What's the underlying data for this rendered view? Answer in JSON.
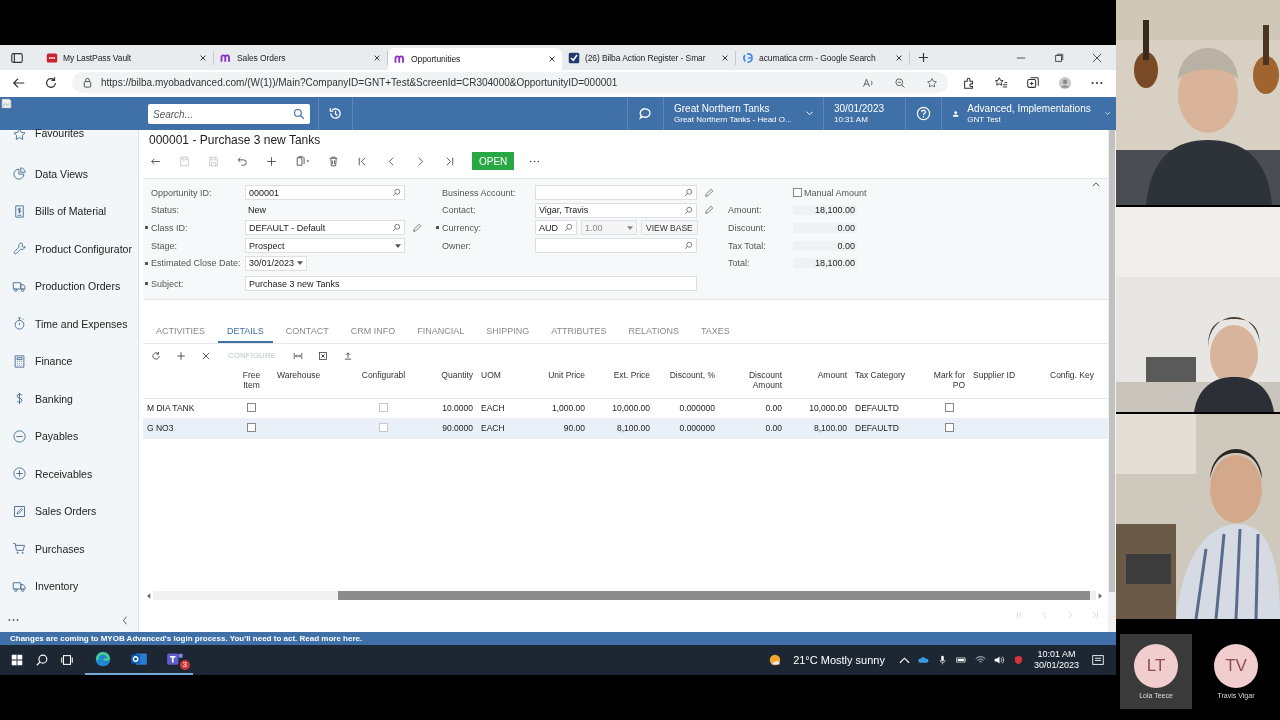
{
  "browser": {
    "tabs": [
      {
        "title": "My LastPass Vault",
        "selected": false
      },
      {
        "title": "Sales Orders",
        "selected": false
      },
      {
        "title": "Opportunities",
        "selected": true
      },
      {
        "title": "(26) Bilba Action Register - Smar",
        "selected": false
      },
      {
        "title": "acumatica crm - Google Search",
        "selected": false
      }
    ],
    "url": "https://bilba.myobadvanced.com/(W(1))/Main?CompanyID=GNT+Test&ScreenId=CR304000&OpportunityID=000001"
  },
  "header": {
    "search": {
      "placeholder": "Search..."
    },
    "company": "Great Northern Tanks",
    "branch": "Great Northern Tanks - Head O...",
    "date": "30/01/2023",
    "time": "10:31 AM",
    "user": "Advanced, Implementations",
    "tenant": "GNT Test"
  },
  "sidebar": {
    "items": [
      {
        "label": "Favourites"
      },
      {
        "label": "Data Views"
      },
      {
        "label": "Bills of Material"
      },
      {
        "label": "Product Configurator"
      },
      {
        "label": "Production Orders"
      },
      {
        "label": "Time and Expenses"
      },
      {
        "label": "Finance"
      },
      {
        "label": "Banking"
      },
      {
        "label": "Payables"
      },
      {
        "label": "Receivables"
      },
      {
        "label": "Sales Orders"
      },
      {
        "label": "Purchases"
      },
      {
        "label": "Inventory"
      }
    ]
  },
  "document": {
    "title": "000001 - Purchase 3 new Tanks",
    "status": "OPEN"
  },
  "form": {
    "left": [
      {
        "label": "Opportunity ID:",
        "value": "000001",
        "kind": "lookup",
        "required": false,
        "edit": false
      },
      {
        "label": "Status:",
        "value": "New",
        "kind": "text",
        "required": false,
        "edit": false
      },
      {
        "label": "Class ID:",
        "value": "DEFAULT - Default",
        "kind": "lookup",
        "required": true,
        "edit": true
      },
      {
        "label": "Stage:",
        "value": "Prospect",
        "kind": "select",
        "required": false,
        "edit": false
      },
      {
        "label": "Estimated Close Date:",
        "value": "30/01/2023",
        "kind": "date",
        "required": true,
        "edit": false
      }
    ],
    "middle": [
      {
        "label": "Business Account:",
        "kind": "lookup",
        "required": false,
        "edit": true
      },
      {
        "label": "Contact:",
        "value": "Vigar, Travis",
        "kind": "lookup",
        "required": false,
        "edit": true
      },
      {
        "label": "Currency:",
        "value": "AUD",
        "rate": "1.00",
        "button": "VIEW BASE",
        "kind": "currency",
        "required": true,
        "edit": false
      },
      {
        "label": "Owner:",
        "kind": "lookup",
        "required": false,
        "edit": false
      }
    ],
    "manual_amount": {
      "label": "Manual Amount",
      "checked": false
    },
    "totals": [
      {
        "label": "Amount:",
        "value": "18,100.00"
      },
      {
        "label": "Discount:",
        "value": "0.00"
      },
      {
        "label": "Tax Total:",
        "value": "0.00"
      },
      {
        "label": "Total:",
        "value": "18,100.00"
      }
    ],
    "subject": {
      "label": "Subject:",
      "value": "Purchase 3 new Tanks",
      "required": true
    }
  },
  "detail_tabs": [
    {
      "label": "ACTIVITIES",
      "selected": false
    },
    {
      "label": "DETAILS",
      "selected": true
    },
    {
      "label": "CONTACT",
      "selected": false
    },
    {
      "label": "CRM INFO",
      "selected": false
    },
    {
      "label": "FINANCIAL",
      "selected": false
    },
    {
      "label": "SHIPPING",
      "selected": false
    },
    {
      "label": "ATTRIBUTES",
      "selected": false
    },
    {
      "label": "RELATIONS",
      "selected": false
    },
    {
      "label": "TAXES",
      "selected": false
    }
  ],
  "grid": {
    "configure_button": "CONFIGURE",
    "columns": [
      "",
      "Free Item",
      "Warehouse",
      "Configurabl",
      "Quantity",
      "UOM",
      "Unit Price",
      "Ext. Price",
      "Discount, %",
      "Discount Amount",
      "Amount",
      "Tax Category",
      "Mark for PO",
      "Supplier ID",
      "Config. Key"
    ],
    "rows": [
      {
        "selected": false,
        "cells": [
          "M DIA TANK",
          {
            "checked": false
          },
          "",
          {
            "checked": false
          },
          "10.0000",
          "EACH",
          "1,000.00",
          "10,000.00",
          "0.000000",
          "0.00",
          "10,000.00",
          "DEFAULTD",
          {
            "checked": false
          },
          "",
          ""
        ]
      },
      {
        "selected": true,
        "cells": [
          "G NO3",
          {
            "checked": false
          },
          "",
          {
            "checked": false
          },
          "90.0000",
          "EACH",
          "90.00",
          "8,100.00",
          "0.000000",
          "0.00",
          "8,100.00",
          "DEFAULTD",
          {
            "checked": false
          },
          "",
          ""
        ]
      }
    ]
  },
  "banner": "Changes are coming to MYOB Advanced's login process. You'll need to act. Read more here.",
  "taskbar": {
    "weather": "21°C Mostly sunny",
    "time": "10:01 AM",
    "date": "30/01/2023",
    "teams_badge": "3"
  },
  "call": {
    "participants": [
      {
        "initials": "LT",
        "name": "Lola Teece",
        "speaking": true
      },
      {
        "initials": "TV",
        "name": "Travis Vigar",
        "speaking": false
      }
    ]
  }
}
